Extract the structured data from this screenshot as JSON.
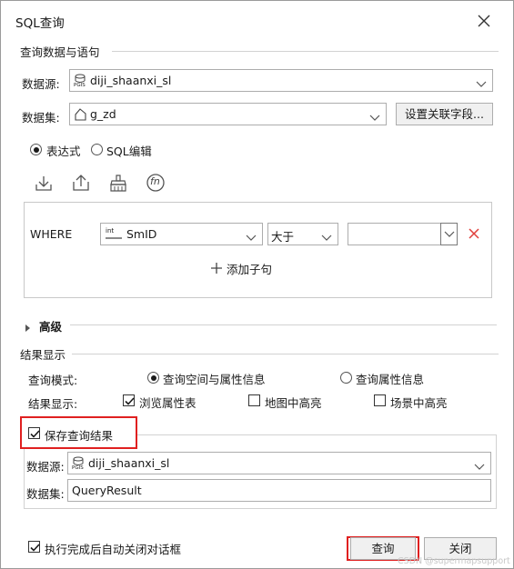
{
  "window": {
    "title": "SQL查询"
  },
  "query_group": {
    "label": "查询数据与语句",
    "datasource_label": "数据源:",
    "datasource_value": "diji_shaanxi_sl",
    "datasource_icon_text": "PGIS",
    "dataset_label": "数据集:",
    "dataset_value": "g_zd",
    "set_fields_button": "设置关联字段...",
    "mode_expression": "表达式",
    "mode_sql_edit": "SQL编辑",
    "mode_selected": "表达式"
  },
  "toolbar": {
    "icons": [
      "import-icon",
      "export-icon",
      "clear-icon",
      "function-icon"
    ],
    "function_glyph": "fn"
  },
  "where_clause": {
    "keyword": "WHERE",
    "field_type_badge": "int",
    "field_value": "SmID",
    "operator_value": "大于",
    "value_input": "",
    "add_clause_label": "添加子句"
  },
  "advanced": {
    "label": "高级"
  },
  "result_group": {
    "label": "结果显示",
    "query_mode_label": "查询模式:",
    "query_mode_spatial": "查询空间与属性信息",
    "query_mode_attribute": "查询属性信息",
    "query_mode_selected": "查询空间与属性信息",
    "display_label": "结果显示:",
    "browse_attribute_table": "浏览属性表",
    "browse_attribute_table_checked": true,
    "map_highlight": "地图中高亮",
    "map_highlight_checked": false,
    "scene_highlight": "场景中高亮",
    "scene_highlight_checked": false
  },
  "save_group": {
    "label": "保存查询结果",
    "checked": true,
    "datasource_label": "数据源:",
    "datasource_value": "diji_shaanxi_sl",
    "datasource_icon_text": "PGIS",
    "dataset_label": "数据集:",
    "dataset_value": "QueryResult"
  },
  "footer": {
    "auto_close_label": "执行完成后自动关闭对话框",
    "auto_close_checked": true,
    "query_button": "查询",
    "close_button": "关闭",
    "watermark": "CSDN @supermapsupport"
  },
  "colors": {
    "highlight_red": "#e02020",
    "delete_red": "#e0403c",
    "border": "#adadad"
  }
}
